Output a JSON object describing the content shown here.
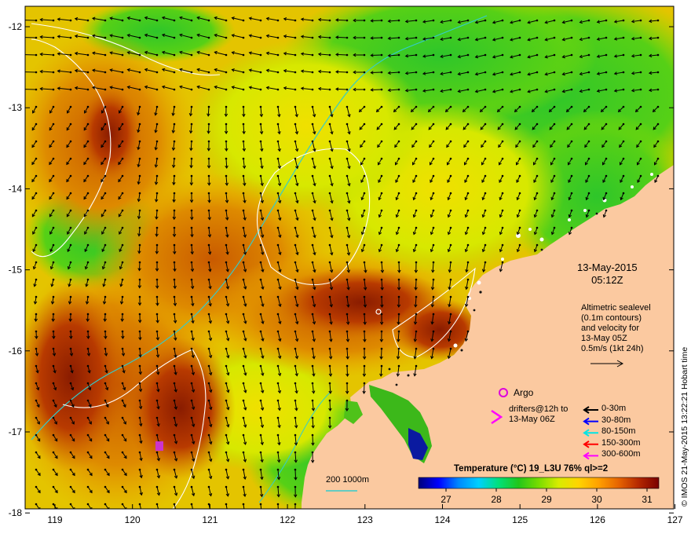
{
  "map": {
    "lat_labels": [
      "-12",
      "-13",
      "-14",
      "-15",
      "-16",
      "-17",
      "-18"
    ],
    "lon_labels": [
      "119",
      "120",
      "121",
      "122",
      "123",
      "124",
      "125",
      "126",
      "127"
    ],
    "date": "13-May-2015",
    "time": "05:12Z",
    "altimetry_lines": [
      "Altimetric sealevel",
      "(0.1m contours)",
      "and velocity for",
      "13-May 05Z",
      "0.5m/s (1kt 24h)"
    ],
    "argo_label": "Argo",
    "drifters_line1": "drifters@12h to",
    "drifters_line2": "13-May 06Z",
    "depth_legend": [
      {
        "label": "0-30m",
        "color": "#000000"
      },
      {
        "label": "30-80m",
        "color": "#0000ff"
      },
      {
        "label": "80-150m",
        "color": "#00e5e5"
      },
      {
        "label": "150-300m",
        "color": "#ff0000"
      },
      {
        "label": "300-600m",
        "color": "#ff00ff"
      }
    ],
    "colorbar_title": "Temperature (°C) 19_L3U 76% ql>=2",
    "colorbar_ticks": [
      "27",
      "28",
      "29",
      "30",
      "31"
    ],
    "scale_label": "200  1000m",
    "credit": "© IMOS 21-May-2015 13:22:21 Hobart time",
    "colors": {
      "land": "#fbc9a0",
      "contour": "#ffffff",
      "isobath": "#33cccc",
      "argo": "#dd00dd",
      "drifter": "#ff00ff"
    },
    "colorbar_stops": [
      "#00007a",
      "#0000ff",
      "#0088ff",
      "#00d0ff",
      "#00e07a",
      "#22c61a",
      "#78dc00",
      "#d8ec00",
      "#ffd400",
      "#ffa000",
      "#e66400",
      "#b42800",
      "#7a0000"
    ]
  }
}
